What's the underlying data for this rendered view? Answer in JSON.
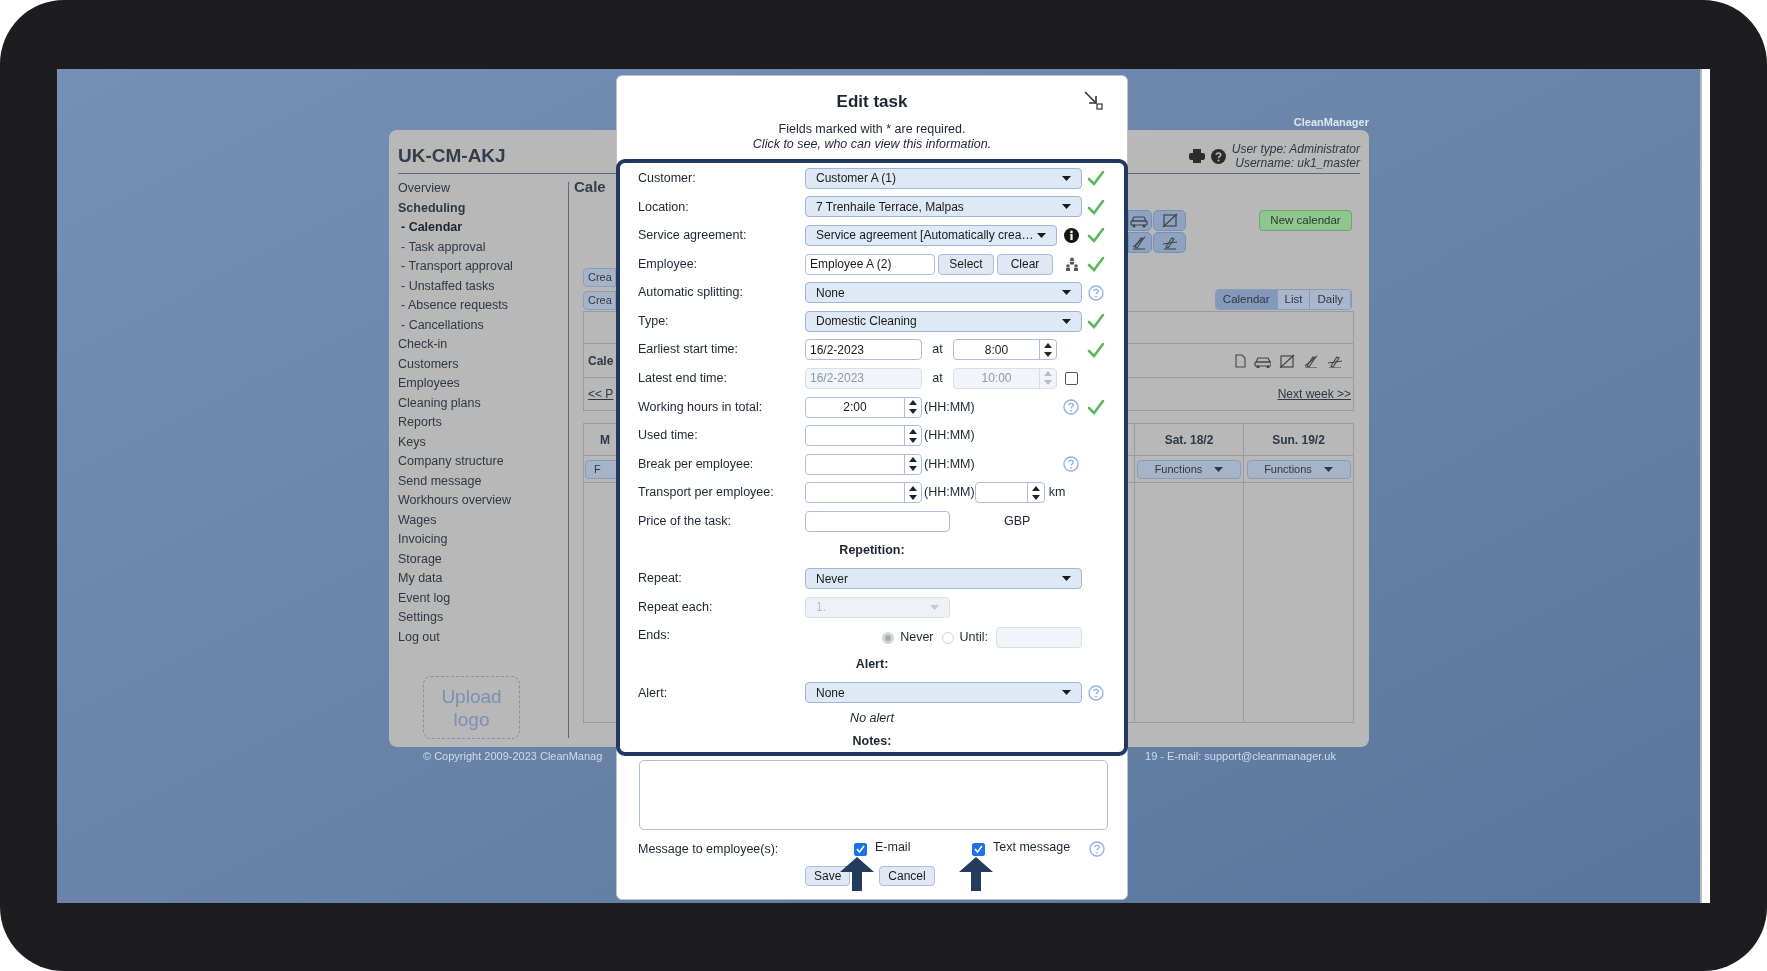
{
  "app": {
    "brand": "CleanManager",
    "title": "UK-CM-AKJ",
    "user_type": "User type: Administrator",
    "username": "Username: uk1_master",
    "sidebar": [
      {
        "label": "Overview",
        "kind": "item",
        "selected": false
      },
      {
        "label": "Scheduling",
        "kind": "section",
        "selected": false
      },
      {
        "label": "- Calendar",
        "kind": "subitem",
        "selected": true
      },
      {
        "label": "- Task approval",
        "kind": "subitem",
        "selected": false
      },
      {
        "label": "- Transport approval",
        "kind": "subitem",
        "selected": false
      },
      {
        "label": "- Unstaffed tasks",
        "kind": "subitem",
        "selected": false
      },
      {
        "label": "- Absence requests",
        "kind": "subitem",
        "selected": false
      },
      {
        "label": "- Cancellations",
        "kind": "subitem",
        "selected": false
      },
      {
        "label": "Check-in",
        "kind": "item",
        "selected": false
      },
      {
        "label": "Customers",
        "kind": "item",
        "selected": false
      },
      {
        "label": "Employees",
        "kind": "item",
        "selected": false
      },
      {
        "label": "Cleaning plans",
        "kind": "item",
        "selected": false
      },
      {
        "label": "Reports",
        "kind": "item",
        "selected": false
      },
      {
        "label": "Keys",
        "kind": "item",
        "selected": false
      },
      {
        "label": "Company structure",
        "kind": "item",
        "selected": false
      },
      {
        "label": "Send message",
        "kind": "item",
        "selected": false
      },
      {
        "label": "Workhours overview",
        "kind": "item",
        "selected": false
      },
      {
        "label": "Wages",
        "kind": "item",
        "selected": false
      },
      {
        "label": "Invoicing",
        "kind": "item",
        "selected": false
      },
      {
        "label": "Storage",
        "kind": "item",
        "selected": false
      },
      {
        "label": "My data",
        "kind": "item",
        "selected": false
      },
      {
        "label": "Event log",
        "kind": "item",
        "selected": false
      },
      {
        "label": "Settings",
        "kind": "item",
        "selected": false
      },
      {
        "label": "Log out",
        "kind": "item",
        "selected": false
      }
    ],
    "upload_logo": "Upload logo",
    "main_left": {
      "heading": "Cale",
      "buttons": [
        "Crea",
        "Crea"
      ],
      "box_label": "Cale",
      "prev_link": "<< P",
      "day_header": "M",
      "functions": "F"
    },
    "main_right": {
      "new_calendar": "New calendar",
      "views": [
        {
          "label": "Calendar",
          "selected": true
        },
        {
          "label": "List",
          "selected": false
        },
        {
          "label": "Daily",
          "selected": false
        }
      ],
      "next_link": "Next week >>",
      "days": [
        {
          "header": "Sat. 18/2",
          "functions": "Functions"
        },
        {
          "header": "Sun. 19/2",
          "functions": "Functions"
        }
      ]
    },
    "footer_left": "© Copyright 2009-2023 CleanManag",
    "footer_right": "19 - E-mail: support@cleanmanager.uk"
  },
  "dialog": {
    "title": "Edit task",
    "note": "Fields marked with * are required.",
    "visibility_link": "Click to see, who can view this information.",
    "fields": [
      {
        "kind": "select",
        "label": "Customer:",
        "value": "Customer A (1)",
        "disabled": false,
        "valid": true
      },
      {
        "kind": "select",
        "label": "Location:",
        "value": "7 Trenhaile Terrace, Malpas",
        "disabled": false,
        "valid": true
      },
      {
        "kind": "select",
        "label": "Service agreement:",
        "value": "Service agreement [Automatically crea…",
        "disabled": false,
        "valid": true
      },
      {
        "kind": "employee",
        "label": "Employee:",
        "value": "Employee A (2)",
        "buttons": [
          "Select",
          "Clear"
        ],
        "valid": true
      },
      {
        "kind": "select",
        "label": "Automatic splitting:",
        "value": "None",
        "disabled": false,
        "valid": false
      },
      {
        "kind": "select",
        "label": "Type:",
        "value": "Domestic Cleaning",
        "disabled": false,
        "valid": true
      },
      {
        "kind": "datetime",
        "label": "Earliest start time:",
        "date": "16/2-2023",
        "at": "at",
        "time": "8:00",
        "disabled": false,
        "valid": true
      },
      {
        "kind": "datetime",
        "label": "Latest end time:",
        "date": "16/2-2023",
        "at": "at",
        "time": "10:00",
        "disabled": true,
        "checked": false,
        "valid": false
      },
      {
        "kind": "duration",
        "label": "Working hours in total:",
        "value": "2:00",
        "unit": "(HH:MM)",
        "valid": true
      },
      {
        "kind": "duration",
        "label": "Used time:",
        "unit": "(HH:MM)",
        "valid": false
      },
      {
        "kind": "duration",
        "label": "Break per employee:",
        "unit": "(HH:MM)",
        "valid": false
      },
      {
        "kind": "transport",
        "label": "Transport per employee:",
        "unit": "(HH:MM)",
        "distance_unit": "km",
        "valid": false
      },
      {
        "kind": "price",
        "label": "Price of the task:",
        "currency": "GBP",
        "valid": false
      },
      {
        "kind": "heading",
        "label": "Repetition:"
      },
      {
        "kind": "select",
        "label": "Repeat:",
        "value": "Never",
        "disabled": false,
        "valid": false
      },
      {
        "kind": "select",
        "label": "Repeat each:",
        "value": "1.",
        "disabled": true,
        "valid": false
      },
      {
        "kind": "radio",
        "label": "Ends:",
        "disabled": true,
        "options": [
          {
            "label": "Never",
            "selected": true
          },
          {
            "label": "Until:",
            "selected": false
          }
        ]
      },
      {
        "kind": "heading",
        "label": "Alert:"
      },
      {
        "kind": "select",
        "label": "Alert:",
        "value": "None",
        "disabled": false,
        "valid": false
      },
      {
        "kind": "caption",
        "label": "No alert"
      },
      {
        "kind": "heading",
        "label": "Notes:"
      }
    ],
    "message": {
      "label": "Message to employee(s):",
      "options": [
        {
          "label": "E-mail",
          "checked": true
        },
        {
          "label": "Text message",
          "checked": true
        }
      ]
    },
    "buttons": [
      "Save",
      "Cancel"
    ]
  }
}
